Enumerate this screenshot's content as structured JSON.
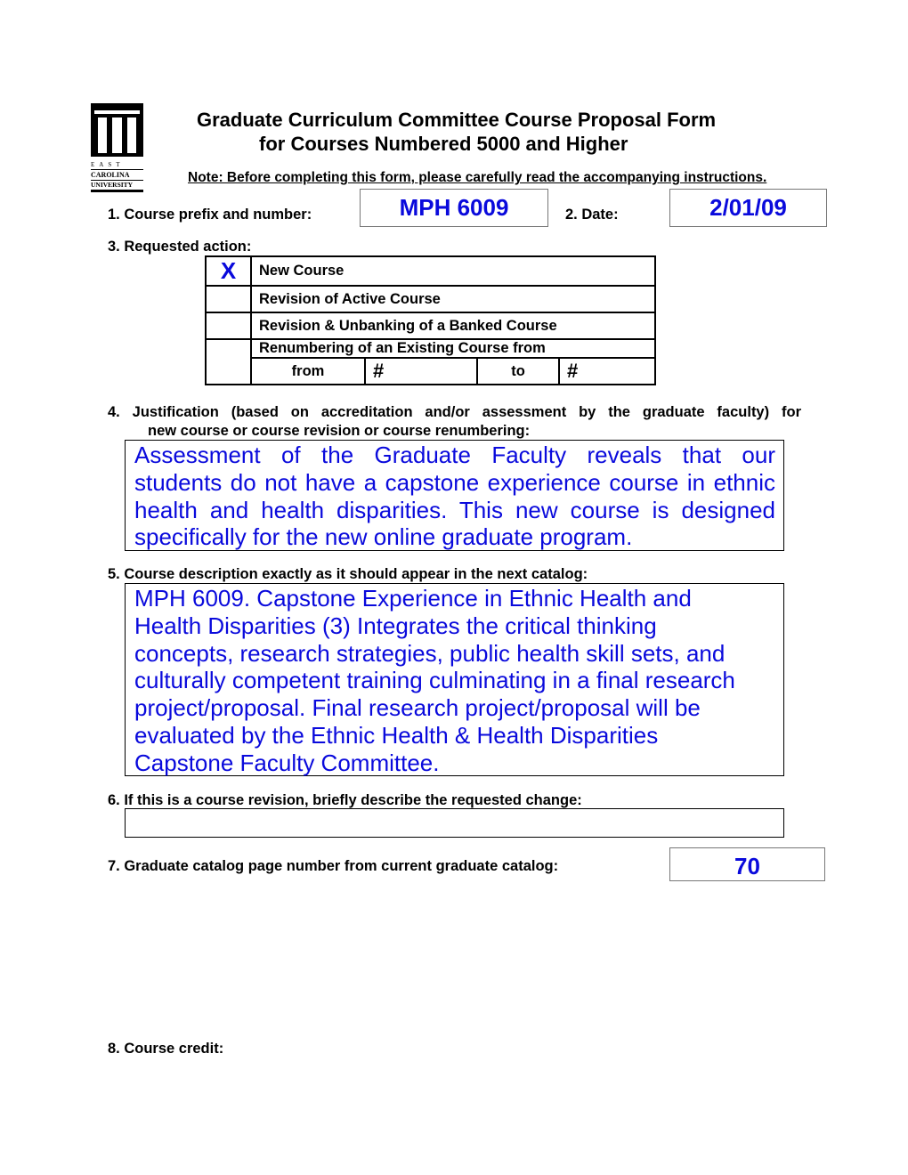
{
  "logo": {
    "text": "EAST CAROLINA UNIVERSITY"
  },
  "header": {
    "title_line1": "Graduate Curriculum Committee Course Proposal Form",
    "title_line2": "for Courses Numbered 5000 and Higher",
    "note": "Note: Before completing this form, please carefully read the accompanying instructions."
  },
  "q1": {
    "label": "1. Course prefix and number:",
    "value": "MPH 6009"
  },
  "q2": {
    "label": "2. Date:",
    "value": "2/01/09"
  },
  "q3": {
    "label": "3. Requested action:",
    "options": [
      {
        "mark": "X",
        "label": "New Course"
      },
      {
        "mark": "",
        "label": "Revision of Active Course"
      },
      {
        "mark": "",
        "label": "Revision & Unbanking of a Banked Course"
      },
      {
        "mark": "",
        "label": "Renumbering of an Existing Course from"
      }
    ],
    "from_label": "from",
    "from_value": "#",
    "to_label": "to",
    "to_value": "#"
  },
  "q4": {
    "label_line1": "4. Justification (based on accreditation and/or assessment by the graduate faculty) for",
    "label_line2": "new course or course revision or course renumbering:",
    "lines": [
      "Assessment of the Graduate Faculty reveals that our",
      "students do not have a capstone experience course in ethnic",
      "health and health disparities. This new course is designed",
      "specifically for the new online graduate program."
    ]
  },
  "q5": {
    "label": "5. Course description exactly as it should appear in the next catalog:",
    "lines": [
      "MPH 6009. Capstone Experience in Ethnic Health and",
      "Health Disparities (3) Integrates the critical thinking",
      "concepts, research strategies, public health skill sets, and",
      "culturally competent training culminating in a final research",
      "project/proposal. Final research project/proposal will be",
      "evaluated by the Ethnic Health & Health Disparities",
      "Capstone Faculty Committee."
    ]
  },
  "q6": {
    "label": "6. If this is a course revision, briefly describe the requested change:",
    "value": ""
  },
  "q7": {
    "label": "7. Graduate catalog page number from current graduate catalog:",
    "value": "70"
  },
  "q8": {
    "label": "8. Course credit:"
  }
}
